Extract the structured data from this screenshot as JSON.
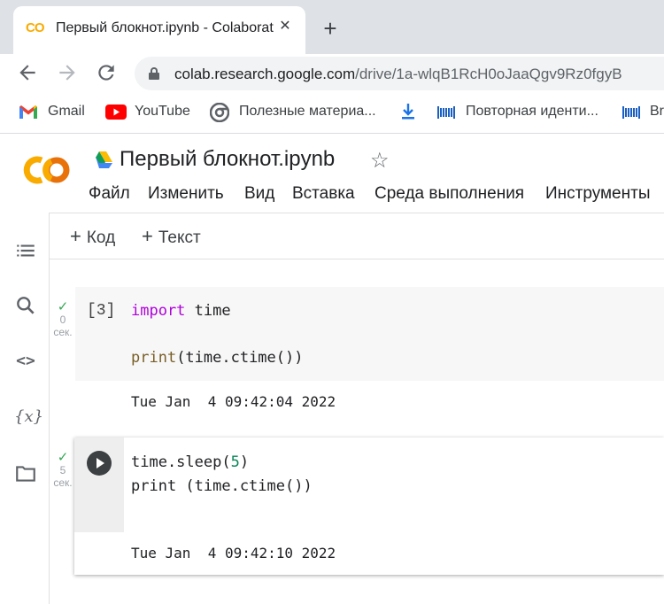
{
  "browser": {
    "tab_title": "Первый блокнот.ipynb - Colaboratory",
    "tab_favicon": "CO",
    "url_host": "colab.research.google.com",
    "url_path": "/drive/1a-wlqB1RcH0oJaaQgv9Rz0fgyB",
    "bookmarks": [
      {
        "label": "Gmail",
        "icon": "gmail-icon"
      },
      {
        "label": "YouTube",
        "icon": "youtube-icon"
      },
      {
        "label": "Полезные материа...",
        "icon": "chrome-app-icon"
      },
      {
        "label": "",
        "icon": "download-icon"
      },
      {
        "label": "Повторная иденти...",
        "icon": "barcode-icon"
      },
      {
        "label": "Br",
        "icon": "barcode-icon"
      }
    ]
  },
  "colab": {
    "logo": "CO",
    "notebook_title": "Первый блокнот.ipynb",
    "menu": [
      "Файл",
      "Изменить",
      "Вид",
      "Вставка",
      "Среда выполнения",
      "Инструменты"
    ],
    "add_code": "Код",
    "add_text": "Текст"
  },
  "cells": [
    {
      "exec_count": "[3]",
      "status_time": "0",
      "status_unit": "сек.",
      "code_lines": [
        {
          "kw": "import",
          "rest": " time"
        },
        {
          "fn": "print",
          "rest": "(time.ctime())"
        }
      ],
      "output": "Tue Jan  4 09:42:04 2022"
    },
    {
      "status_time": "5",
      "status_unit": "сек.",
      "code_line1_pre": "time.sleep(",
      "code_line1_num": "5",
      "code_line1_post": ")",
      "code_line2": "print (time.ctime())",
      "output": "Tue Jan  4 09:42:10 2022"
    }
  ],
  "colors": {
    "accent_orange": "#f9ab00",
    "accent_dark_orange": "#e8710a",
    "success_green": "#34a853",
    "keyword_purple": "#af00db"
  }
}
